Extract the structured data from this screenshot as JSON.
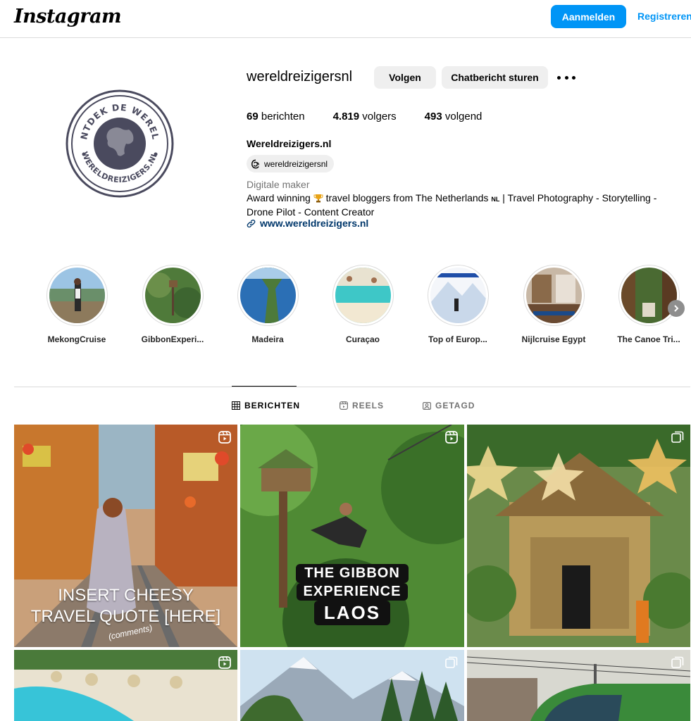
{
  "header": {
    "logo_text": "Instagram",
    "login_label": "Aanmelden",
    "register_label": "Registreren"
  },
  "profile": {
    "username": "wereldreizigersnl",
    "follow_label": "Volgen",
    "message_label": "Chatbericht sturen",
    "avatar_text_top": "ONTDEK DE WERELD",
    "avatar_text_bottom": "WERELDREIZIGERS.NL",
    "stats": {
      "posts_count": "69",
      "posts_label": "berichten",
      "followers_count": "4.819",
      "followers_label": "volgers",
      "following_count": "493",
      "following_label": "volgend"
    },
    "full_name": "Wereldreizigers.nl",
    "threads_handle": "wereldreizigersnl",
    "category": "Digitale maker",
    "bio_part1": "Award winning",
    "bio_part2": "travel bloggers from The Netherlands",
    "bio_flag": "NL",
    "bio_part3": "| Travel Photography - Storytelling - Drone Pilot - Content Creator",
    "website": "www.wereldreizigers.nl"
  },
  "highlights": [
    {
      "label": "MekongCruise"
    },
    {
      "label": "GibbonExperi..."
    },
    {
      "label": "Madeira"
    },
    {
      "label": "Curaçao"
    },
    {
      "label": "Top of Europ..."
    },
    {
      "label": "Nijlcruise Egypt"
    },
    {
      "label": "The Canoe Tri..."
    }
  ],
  "tabs": [
    {
      "label": "BERICHTEN",
      "icon": "grid-icon",
      "active": true
    },
    {
      "label": "REELS",
      "icon": "reels-icon",
      "active": false
    },
    {
      "label": "GETAGD",
      "icon": "tagged-icon",
      "active": false
    }
  ],
  "posts": {
    "p1_line1": "INSERT CHEESY",
    "p1_line2": "TRAVEL QUOTE [HERE]",
    "p1_sub": "(comments)",
    "p2_line1": "THE GIBBON",
    "p2_line2": "EXPERIENCE",
    "p2_line3": "LAOS"
  },
  "colors": {
    "accent": "#0095f6",
    "link": "#00376b",
    "muted": "#737373"
  }
}
